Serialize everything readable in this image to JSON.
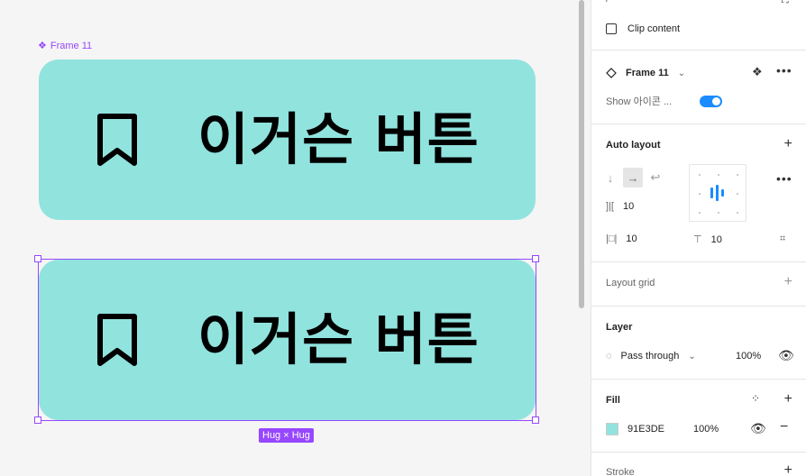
{
  "canvas": {
    "frame_label": "Frame 11",
    "button_text": "이거슨 버튼",
    "hug_badge": "Hug × Hug",
    "fill_color": "#91E3DE",
    "selection_color": "#9747FF"
  },
  "panel": {
    "clip_content": "Clip content",
    "component": {
      "name": "Frame 11",
      "prop_label": "Show 아이콘 ...",
      "prop_value": true
    },
    "auto_layout": {
      "title": "Auto layout",
      "gap": "10",
      "padding_h": "10",
      "padding_v": "10"
    },
    "layout_grid": {
      "title": "Layout grid"
    },
    "layer": {
      "title": "Layer",
      "blend": "Pass through",
      "opacity": "100%"
    },
    "fill": {
      "title": "Fill",
      "hex": "91E3DE",
      "opacity": "100%"
    },
    "stroke": {
      "title": "Stroke"
    }
  },
  "colors": {
    "accent": "#1A8CFF",
    "component_purple": "#9747FF",
    "button_fill": "#91E3DE"
  }
}
